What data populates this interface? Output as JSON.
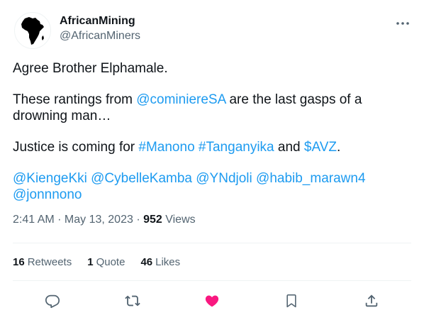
{
  "author": {
    "display_name": "AfricanMining",
    "handle": "@AfricanMiners"
  },
  "tweet": {
    "line1": "Agree Brother Elphamale.",
    "p2_pre": "These rantings from ",
    "p2_mention": "@cominiereSA",
    "p2_post": " are the last gasps of a drowning man…",
    "p3_pre": "Justice is coming for ",
    "p3_tag1": "#Manono",
    "p3_sep": " ",
    "p3_tag2": "#Tanganyika",
    "p3_mid": " and ",
    "p3_cashtag": "$AVZ",
    "p3_end": ".",
    "mentions": [
      "@KiengeKki",
      "@CybelleKamba",
      "@YNdjoli",
      "@habib_marawn4",
      "@jonnnono"
    ]
  },
  "meta": {
    "time": "2:41 AM",
    "sep1": " · ",
    "date": "May 13, 2023",
    "sep2": " · ",
    "views_count": "952",
    "views_label": " Views"
  },
  "stats": {
    "retweets_count": "16",
    "retweets_label": "Retweets",
    "quotes_count": "1",
    "quotes_label": "Quote",
    "likes_count": "46",
    "likes_label": "Likes"
  },
  "icons": {
    "more": "more-horizontal-icon",
    "reply": "reply-icon",
    "retweet": "retweet-icon",
    "like": "heart-filled-icon",
    "bookmark": "bookmark-icon",
    "share": "share-icon"
  },
  "colors": {
    "link": "#1d9bf0",
    "like": "#f91880",
    "muted": "#536471",
    "text": "#0f1419"
  }
}
